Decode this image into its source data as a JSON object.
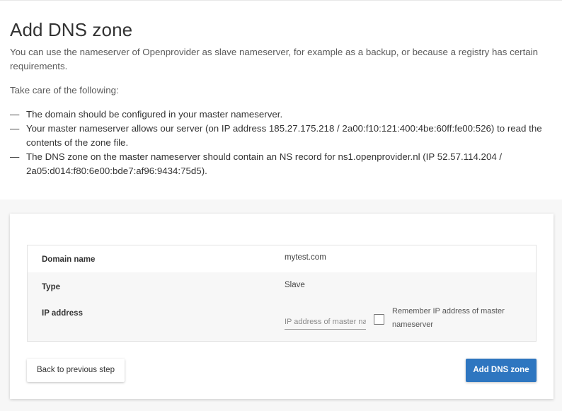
{
  "header": {
    "title": "Add DNS zone",
    "intro": "You can use the nameserver of Openprovider as slave nameserver, for example as a backup, or because a registry has certain requirements.",
    "take_care": "Take care of the following:",
    "requirements": [
      "The domain should be configured in your master nameserver.",
      "Your master nameserver allows our server (on IP address 185.27.175.218 / 2a00:f10:121:400:4be:60ff:fe00:526) to read the contents of the zone file.",
      "The DNS zone on the master nameserver should contain an NS record for ns1.openprovider.nl (IP 52.57.114.204 / 2a05:d014:f80:6e00:bde7:af96:9434:75d5)."
    ],
    "dash": "—"
  },
  "form": {
    "domain_label": "Domain name",
    "domain_value": "mytest.com",
    "type_label": "Type",
    "type_value": "Slave",
    "ip_label": "IP address",
    "ip_placeholder": "IP address of master nameserver",
    "ip_value": "",
    "remember_label": "Remember IP address of master nameserver",
    "remember_checked": false
  },
  "actions": {
    "back_label": "Back to previous step",
    "add_label": "Add DNS zone"
  },
  "colors": {
    "primary": "#2e76c0",
    "background": "#f7f7f7"
  }
}
